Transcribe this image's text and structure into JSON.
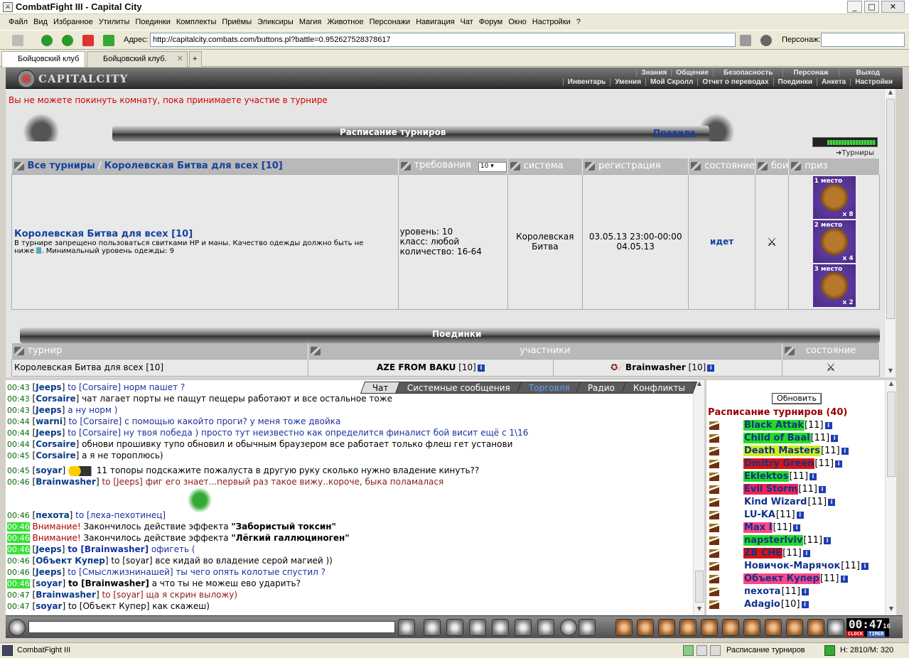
{
  "window": {
    "title": "CombatFight III - Capital City"
  },
  "menu": [
    "Файл",
    "Вид",
    "Избранное",
    "Утилиты",
    "Поединки",
    "Комплекты",
    "Приёмы",
    "Эликсиры",
    "Магия",
    "Животное",
    "Персонажи",
    "Навигация",
    "Чат",
    "Форум",
    "Окно",
    "Настройки",
    "?"
  ],
  "address": {
    "label": "Адрес:",
    "url": "http://capitalcity.combats.com/buttons.pl?battle=0.952627528378617",
    "persona_label": "Персонаж:"
  },
  "tabs": [
    {
      "label": "Бойцовский клуб"
    },
    {
      "label": "Бойцовский клуб."
    }
  ],
  "header": {
    "logo": "CAPITALCITY",
    "row1": [
      "Знания",
      "Общение",
      "Безопасность",
      "Персонаж",
      "Выход"
    ],
    "row2": [
      "Инвентарь",
      "Умения",
      "Мой Скролл",
      "Отчет о переводах",
      "Поединки",
      "Анкета",
      "Настройки"
    ]
  },
  "upper": {
    "warning": "Вы не можете покинуть комнату, пока принимаете участие в турнире",
    "schedule_title": "Расписание турниров",
    "rules_link": "Правила",
    "tournaments_link": "Турниры",
    "breadcrumb_all": "Все турниры",
    "breadcrumb_sep": "/",
    "breadcrumb_cur": "Королевская Битва для всех [10]",
    "cols": {
      "req": "требования",
      "req_select": "10",
      "sys": "система",
      "reg": "регистрация",
      "state": "состояние",
      "fights": "бои",
      "prize": "приз"
    },
    "row": {
      "name": "Королевская Битва для всех [10]",
      "desc1": "В турнире запрещено пользоваться свитками HP и маны. Качество одежды должно быть не",
      "desc2": "ниже",
      "desc3": ". Минимальный уровень одежды: 9",
      "req1": "уровень: 10",
      "req2": "класс: любой",
      "req3": "количество: 16-64",
      "sys1": "Королевская",
      "sys2": "Битва",
      "reg1": "03.05.13 23:00-00:00",
      "reg2": "04.05.13",
      "state": "идет",
      "prizes": [
        {
          "place": "1 место",
          "qty": "x 8"
        },
        {
          "place": "2 место",
          "qty": "x 4"
        },
        {
          "place": "3 место",
          "qty": "x 2"
        }
      ]
    },
    "duels_title": "Поединки",
    "duels_cols": {
      "tourn": "турнир",
      "part": "участники",
      "state": "состояние"
    },
    "duel_row": {
      "tourn": "Королевская Битва для всех [10]",
      "p1": "AZE FROM BAKU",
      "p1lvl": "[10]",
      "p2": "Brainwasher",
      "p2lvl": "[10]"
    }
  },
  "chat_tabs": [
    "Чат",
    "Системные сообщения",
    "Торговля",
    "Радио",
    "Конфликты"
  ],
  "chat": {
    "l1": {
      "t": "00:43",
      "n": "Jeeps",
      "to": "to [Corsaire]",
      "m": "норм пашет ?"
    },
    "l2": {
      "t": "00:43",
      "n": "Corsaire",
      "m": "чат лагает порты не пащут пещеры работают и все остальное тоже"
    },
    "l3": {
      "t": "00:43",
      "n": "Jeeps",
      "m": "а ну норм )"
    },
    "l4": {
      "t": "00:44",
      "n": "warni",
      "to": "to [Corsaire]",
      "m": "с помощью какойто проги? у меня тоже двойка"
    },
    "l5": {
      "t": "00:44",
      "n": "Jeeps",
      "to": "to [Corsaire]",
      "m": "ну твоя победа ) просто тут неизвестно как определится финалист бой висит ещё с 1\\16"
    },
    "l6": {
      "t": "00:44",
      "n": "Corsaire",
      "m": "обнови прошивку тупо обновил и обычным браузером все работает только флеш гет установи"
    },
    "l7": {
      "t": "00:45",
      "n": "Corsaire",
      "m": "а я не тороплюсь)"
    },
    "l8": {
      "t": "00:45",
      "n": "soyar",
      "m": "11 топоры подскажите пожалуста в другую руку сколько нужно владение кинуть??"
    },
    "l9": {
      "t": "00:46",
      "n": "Brainwasher",
      "to": "to [Jeeps]",
      "m": "фиг его знает...первый раз такое вижу..короче, быка поламалася"
    },
    "l10": {
      "t": "00:46",
      "n": "пехота",
      "to": "to [леха-пехотинец]"
    },
    "l11": {
      "t": "00:46",
      "w": "Внимание!",
      "m": "Закончилось действие эффекта",
      "e": "\"Забористый токсин\""
    },
    "l12": {
      "t": "00:46",
      "w": "Внимание!",
      "m": "Закончилось действие эффекта",
      "e": "\"Лёгкий галлюциноген\""
    },
    "l13": {
      "t": "00:46",
      "n": "Jeeps",
      "to": "to [Brainwasher]",
      "m": "офигеть ("
    },
    "l14": {
      "t": "00:46",
      "n": "Объект Купер",
      "to": "to [soyar]",
      "m": "все кидай во владение серой магией ))"
    },
    "l15": {
      "t": "00:46",
      "n": "Jeeps",
      "to": "to [Смыслжизнинашей]",
      "m": "ты чего опять колотые спустил ?"
    },
    "l16": {
      "t": "00:46",
      "n": "soyar",
      "to": "to [Brainwasher]",
      "m": "а что ты не можеш ево ударить?"
    },
    "l17": {
      "t": "00:47",
      "n": "Brainwasher",
      "to": "to [soyar]",
      "m": "ща я скрин выложу)"
    },
    "l18": {
      "t": "00:47",
      "n": "soyar",
      "to": "to [Объект Купер]",
      "m": "как скажеш)"
    }
  },
  "right": {
    "refresh": "Обновить",
    "title": "Расписание турниров (40)",
    "players": [
      {
        "name": "Black Attak",
        "lvl": "[11]",
        "bg": "#22dd22"
      },
      {
        "name": "Child of Baal",
        "lvl": "[11]",
        "bg": "#22dd22"
      },
      {
        "name": "Death Masters",
        "lvl": "[11]",
        "bg": "#ccf022"
      },
      {
        "name": "Dmitry Green",
        "lvl": "[11]",
        "bg": "#dd1111"
      },
      {
        "name": "Eklektos",
        "lvl": "[11]",
        "bg": "#22dd22"
      },
      {
        "name": "Evil Storm",
        "lvl": "[11]",
        "bg": "#ee2255"
      },
      {
        "name": "Kind Wizard",
        "lvl": "[11]",
        "bg": ""
      },
      {
        "name": "LU-KA",
        "lvl": "[11]",
        "bg": ""
      },
      {
        "name": "Max I",
        "lvl": "[11]",
        "bg": "#ff4488"
      },
      {
        "name": "napsterlviv",
        "lvl": "[11]",
        "bg": "#22dd22"
      },
      {
        "name": "ZB CHE",
        "lvl": "[11]",
        "bg": "#dd1111"
      },
      {
        "name": "Новичок-Марячок",
        "lvl": "[11]",
        "bg": ""
      },
      {
        "name": "Объект Купер",
        "lvl": "[11]",
        "bg": "#ff4488"
      },
      {
        "name": "пехота",
        "lvl": "[11]",
        "bg": ""
      },
      {
        "name": "Adagio",
        "lvl": "[10]",
        "bg": ""
      }
    ]
  },
  "clock": {
    "time": "00:47",
    "sec": "16",
    "l1": "CLOCK",
    "l2": "TIMER"
  },
  "status": {
    "left": "CombatFight III",
    "mid": "Расписание турниров",
    "hp": "H: 2810/M: 320"
  }
}
